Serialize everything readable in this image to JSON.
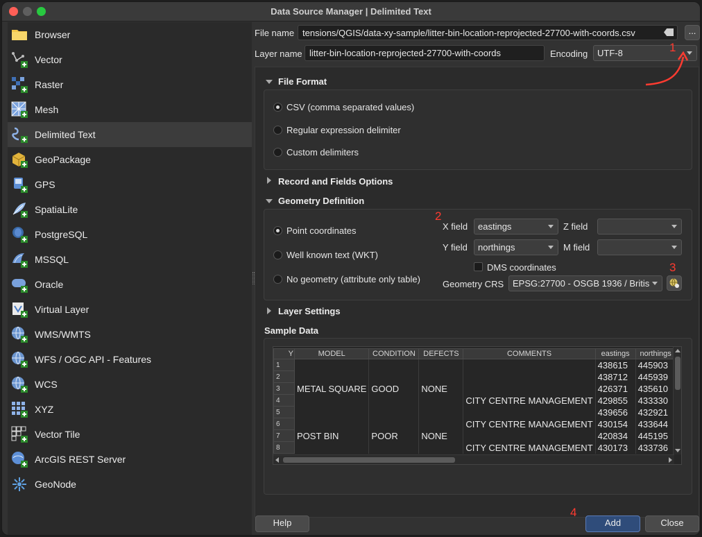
{
  "window": {
    "title": "Data Source Manager | Delimited Text"
  },
  "sidebar": {
    "items": [
      {
        "label": "Browser",
        "icon": "folder-icon"
      },
      {
        "label": "Vector",
        "icon": "vector-icon"
      },
      {
        "label": "Raster",
        "icon": "raster-icon"
      },
      {
        "label": "Mesh",
        "icon": "mesh-icon"
      },
      {
        "label": "Delimited Text",
        "icon": "delimited-text-icon",
        "selected": true
      },
      {
        "label": "GeoPackage",
        "icon": "geopackage-icon"
      },
      {
        "label": "GPS",
        "icon": "gps-icon"
      },
      {
        "label": "SpatiaLite",
        "icon": "spatialite-icon"
      },
      {
        "label": "PostgreSQL",
        "icon": "postgresql-icon"
      },
      {
        "label": "MSSQL",
        "icon": "mssql-icon"
      },
      {
        "label": "Oracle",
        "icon": "oracle-icon"
      },
      {
        "label": "Virtual Layer",
        "icon": "virtual-layer-icon"
      },
      {
        "label": "WMS/WMTS",
        "icon": "wms-icon"
      },
      {
        "label": "WFS / OGC API - Features",
        "icon": "wfs-icon"
      },
      {
        "label": "WCS",
        "icon": "wcs-icon"
      },
      {
        "label": "XYZ",
        "icon": "xyz-icon"
      },
      {
        "label": "Vector Tile",
        "icon": "vector-tile-icon"
      },
      {
        "label": "ArcGIS REST Server",
        "icon": "arcgis-icon"
      },
      {
        "label": "GeoNode",
        "icon": "geonode-icon"
      }
    ]
  },
  "file": {
    "label": "File name",
    "value": "tensions/QGIS/data-xy-sample/litter-bin-location-reprojected-27700-with-coords.csv",
    "browse_label": "..."
  },
  "layer": {
    "label": "Layer name",
    "value": "litter-bin-location-reprojected-27700-with-coords",
    "encoding_label": "Encoding",
    "encoding_value": "UTF-8"
  },
  "file_format": {
    "title": "File Format",
    "options": [
      "CSV (comma separated values)",
      "Regular expression delimiter",
      "Custom delimiters"
    ],
    "selected": 0
  },
  "record_fields": {
    "title": "Record and Fields Options"
  },
  "geometry": {
    "title": "Geometry Definition",
    "options": [
      "Point coordinates",
      "Well known text (WKT)",
      "No geometry (attribute only table)"
    ],
    "selected": 0,
    "x_label": "X field",
    "x_value": "eastings",
    "y_label": "Y field",
    "y_value": "northings",
    "z_label": "Z field",
    "z_value": "",
    "m_label": "M field",
    "m_value": "",
    "dms_label": "DMS coordinates",
    "dms_checked": false,
    "crs_label": "Geometry CRS",
    "crs_value": "EPSG:27700 - OSGB 1936 / Britis"
  },
  "layer_settings": {
    "title": "Layer Settings"
  },
  "sample": {
    "title": "Sample Data",
    "columns": [
      "Y",
      "MODEL",
      "CONDITION",
      "DEFECTS",
      "COMMENTS",
      "eastings",
      "northings"
    ],
    "rows": [
      {
        "n": "1",
        "model": "",
        "condition": "",
        "defects": "",
        "comments": "",
        "eastings": "438615",
        "northings": "445903"
      },
      {
        "n": "2",
        "model": "",
        "condition": "",
        "defects": "",
        "comments": "",
        "eastings": "438712",
        "northings": "445939"
      },
      {
        "n": "3",
        "model": "METAL SQUARE",
        "condition": "GOOD",
        "defects": "NONE",
        "comments": "",
        "eastings": "426371",
        "northings": "435610"
      },
      {
        "n": "4",
        "model": "",
        "condition": "",
        "defects": "",
        "comments": "CITY CENTRE MANAGEMENT",
        "eastings": "429855",
        "northings": "433330"
      },
      {
        "n": "5",
        "model": "",
        "condition": "",
        "defects": "",
        "comments": "",
        "eastings": "439656",
        "northings": "432921"
      },
      {
        "n": "6",
        "model": "",
        "condition": "",
        "defects": "",
        "comments": "CITY CENTRE MANAGEMENT",
        "eastings": "430154",
        "northings": "433644"
      },
      {
        "n": "7",
        "model": "POST BIN",
        "condition": "POOR",
        "defects": "NONE",
        "comments": "",
        "eastings": "420834",
        "northings": "445195"
      },
      {
        "n": "8",
        "model": "",
        "condition": "",
        "defects": "",
        "comments": "CITY CENTRE MANAGEMENT",
        "eastings": "430173",
        "northings": "433736"
      }
    ]
  },
  "footer": {
    "help_label": "Help",
    "add_label": "Add",
    "close_label": "Close"
  },
  "annotations": {
    "a1": "1",
    "a2": "2",
    "a3": "3",
    "a4": "4",
    "color": "#ff3b30"
  }
}
